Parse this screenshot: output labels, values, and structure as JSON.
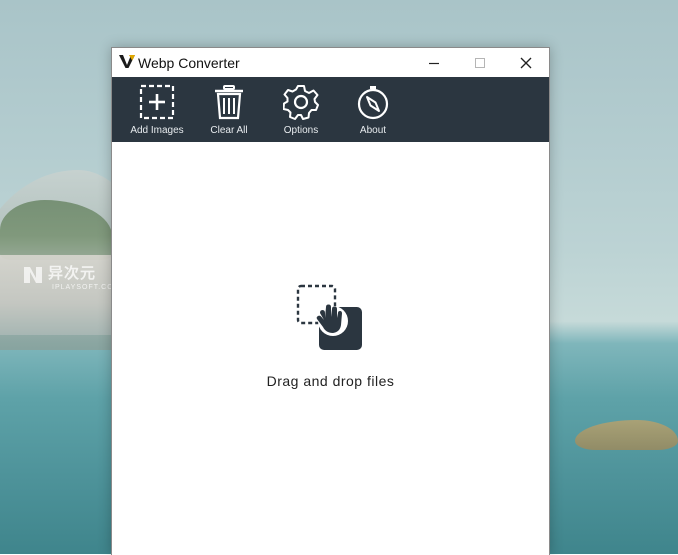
{
  "window": {
    "title": "Webp Converter"
  },
  "toolbar": {
    "items": [
      {
        "label": "Add Images",
        "icon": "add-image-icon"
      },
      {
        "label": "Clear All",
        "icon": "trash-icon"
      },
      {
        "label": "Options",
        "icon": "gear-icon"
      },
      {
        "label": "About",
        "icon": "compass-icon"
      }
    ]
  },
  "droparea": {
    "text": "Drag and drop files",
    "icon": "drag-drop-icon"
  },
  "watermark": {
    "cn": "异次元",
    "en": "IPLAYSOFT.COM"
  },
  "colors": {
    "toolbar_bg": "#2b3640",
    "toolbar_text": "#e8ecef",
    "window_bg": "#ffffff"
  }
}
